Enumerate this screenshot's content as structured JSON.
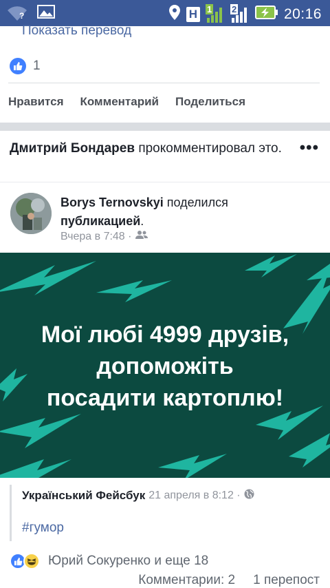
{
  "status_bar": {
    "time": "20:16",
    "icons": [
      "wifi-icon",
      "image-icon",
      "location-icon",
      "h-network-icon",
      "signal-1-icon",
      "signal-2-icon",
      "battery-charging-icon"
    ],
    "h_label": "H",
    "sim1": "1",
    "sim2": "2",
    "wifi_badge": "?"
  },
  "prev_post": {
    "translate_link": "Показать перевод",
    "likes_count": "1",
    "actions": {
      "like": "Нравится",
      "comment": "Комментарий",
      "share": "Поделиться"
    }
  },
  "story": {
    "actor": "Дмитрий Бондарев",
    "action_text": " прокомментировал это.",
    "more_label": "•••"
  },
  "shared_post": {
    "author": "Borys Ternovskyi",
    "shared_text": " поделился ",
    "shared_object": "публикацией",
    "period": ".",
    "timestamp": "Вчера в 7:48 ·",
    "privacy_icon": "friends-icon"
  },
  "image": {
    "line1": "Мої любі 4999 друзів,",
    "line2": "допоможіть",
    "line3": "посадити картоплю!",
    "colors": {
      "background": "#0c4a40",
      "accent": "#1fb5a0"
    }
  },
  "source": {
    "name": "Український Фейсбук",
    "date": "21 апреля в 8:12 ·",
    "privacy_icon": "globe-icon",
    "hashtag": "#гумор"
  },
  "reactions": {
    "names": "Юрий Сокуренко и еще 18",
    "comments": "Комментарии: 2",
    "shares": "1 перепост"
  },
  "colors": {
    "status_bar": "#3b5998",
    "link": "#4b69a3",
    "like_blue": "#4080ff"
  }
}
